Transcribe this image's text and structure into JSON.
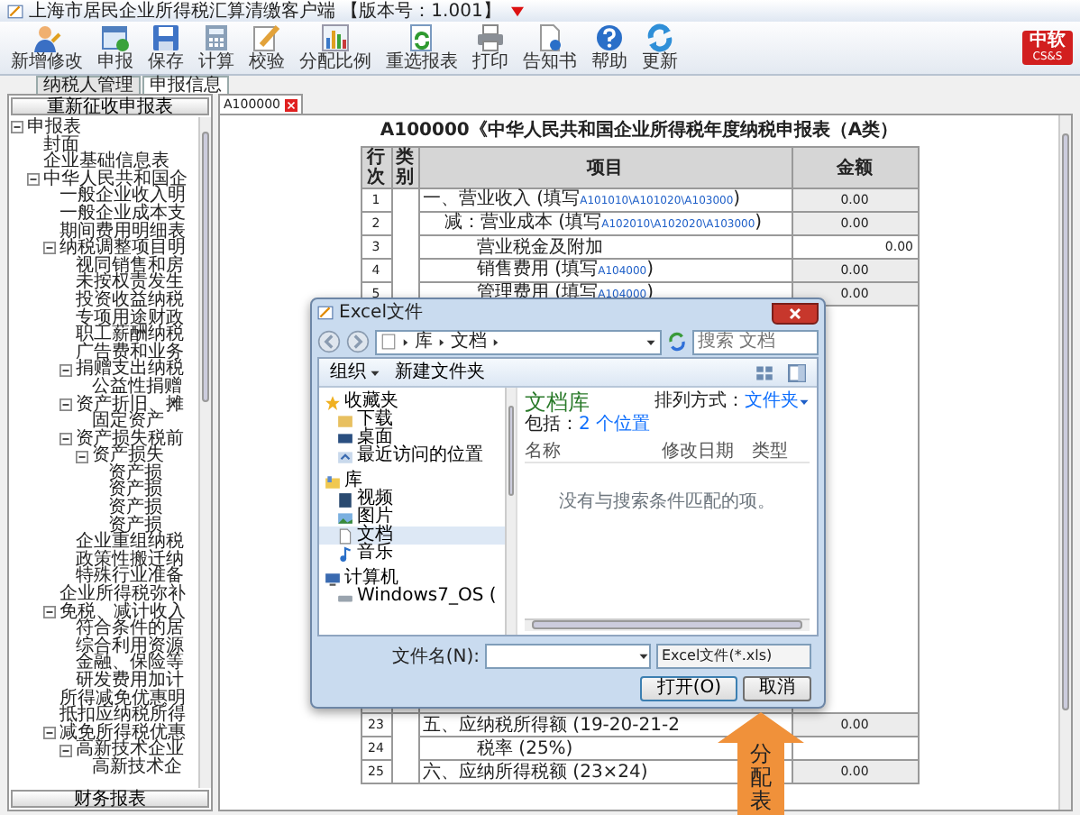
{
  "window": {
    "title": "上海市居民企业所得税汇算清缴客户端 【版本号：1.001】"
  },
  "toolbar": [
    "新增修改",
    "申报",
    "保存",
    "计算",
    "校验",
    "分配比例",
    "重选报表",
    "打印",
    "告知书",
    "帮助",
    "更新"
  ],
  "logo": {
    "text": "中软",
    "subtext": "CS&S"
  },
  "tabs": [
    {
      "label": "纳税人管理",
      "selected": false
    },
    {
      "label": "申报信息",
      "selected": true
    }
  ],
  "left_panel": {
    "top_button": "重新征收申报表",
    "bottom_button": "财务报表",
    "tree": [
      {
        "label": "申报表",
        "expanded": true,
        "children": [
          {
            "label": "封面"
          },
          {
            "label": "企业基础信息表"
          },
          {
            "label": "中华人民共和国企",
            "expanded": true,
            "children": [
              {
                "label": "一般企业收入明"
              },
              {
                "label": "一般企业成本支"
              },
              {
                "label": "期间费用明细表"
              },
              {
                "label": "纳税调整项目明",
                "expanded": true,
                "children": [
                  {
                    "label": "视同销售和房"
                  },
                  {
                    "label": "未按权责发生"
                  },
                  {
                    "label": "投资收益纳税"
                  },
                  {
                    "label": "专项用途财政"
                  },
                  {
                    "label": "职工薪酬纳税"
                  },
                  {
                    "label": "广告费和业务"
                  },
                  {
                    "label": "捐赠支出纳税",
                    "expanded": true,
                    "children": [
                      {
                        "label": "公益性捐赠"
                      }
                    ]
                  },
                  {
                    "label": "资产折旧、摊",
                    "expanded": true,
                    "children": [
                      {
                        "label": "固定资产"
                      }
                    ]
                  },
                  {
                    "label": "资产损失税前",
                    "expanded": true,
                    "children": [
                      {
                        "label": "资产损失",
                        "expanded": true,
                        "children": [
                          {
                            "label": "资产损"
                          },
                          {
                            "label": "资产损"
                          },
                          {
                            "label": "资产损"
                          },
                          {
                            "label": "资产损"
                          }
                        ]
                      }
                    ]
                  },
                  {
                    "label": "企业重组纳税"
                  },
                  {
                    "label": "政策性搬迁纳"
                  },
                  {
                    "label": "特殊行业准备"
                  }
                ]
              },
              {
                "label": "企业所得税弥补"
              },
              {
                "label": "免税、减计收入",
                "expanded": true,
                "children": [
                  {
                    "label": "符合条件的居"
                  },
                  {
                    "label": "综合利用资源"
                  },
                  {
                    "label": "金融、保险等"
                  },
                  {
                    "label": "研发费用加计"
                  }
                ]
              },
              {
                "label": "所得减免优惠明"
              },
              {
                "label": "抵扣应纳税所得"
              },
              {
                "label": "减免所得税优惠",
                "expanded": true,
                "children": [
                  {
                    "label": "高新技术企业",
                    "expanded": true,
                    "children": [
                      {
                        "label": "高新技术企"
                      }
                    ]
                  }
                ]
              }
            ]
          }
        ]
      }
    ]
  },
  "document_tabs": [
    {
      "label": "A100000",
      "selected": true
    }
  ],
  "sheet": {
    "title": "A100000《中华人民共和国企业所得税年度纳税申报表（A类）",
    "columns": [
      "行次",
      "类别",
      "项目",
      "金额"
    ],
    "rows": [
      {
        "line": "1",
        "item": "一、营业收入 (填写",
        "ref": "A101010\\A101020\\A103000",
        "item_end": ")",
        "kind": "heading",
        "amount": "0.00"
      },
      {
        "line": "2",
        "item": "减：营业成本 (填写",
        "ref": "A102010\\A102020\\A103000",
        "item_end": ")",
        "kind": "sub",
        "amount": "0.00"
      },
      {
        "line": "3",
        "item": "营业税金及附加",
        "kind": "entry",
        "amount": "0.00"
      },
      {
        "line": "4",
        "item": "销售费用 (填写",
        "ref": "A104000",
        "item_end": ")",
        "kind": "detail",
        "amount": "0.00"
      },
      {
        "line": "5",
        "item": "管理费用 (填写",
        "ref": "A104000",
        "item_end": ")",
        "kind": "detail",
        "amount": "0.00"
      },
      {
        "line": "23",
        "item": "五、应纳税所得额 (19-20-21-2",
        "kind": "heading",
        "amount": "0.00"
      },
      {
        "line": "24",
        "item": "税率 (25%)",
        "kind": "entry"
      },
      {
        "line": "25",
        "item": "六、应纳所得税额 (23×24)",
        "kind": "heading",
        "amount": "0.00"
      }
    ]
  },
  "dialog": {
    "title": "Excel文件",
    "path": [
      "库",
      "文档"
    ],
    "search_placeholder": "搜索 文档",
    "toolbar": [
      "组织",
      "新建文件夹"
    ],
    "nav": [
      {
        "label": "收藏夹",
        "kind": "group",
        "selected": false
      },
      {
        "label": "下载",
        "kind": "item",
        "selected": false
      },
      {
        "label": "桌面",
        "kind": "item",
        "selected": false
      },
      {
        "label": "最近访问的位置",
        "kind": "item",
        "selected": false
      },
      {
        "label": "库",
        "kind": "group",
        "selected": false
      },
      {
        "label": "视频",
        "kind": "item",
        "selected": false
      },
      {
        "label": "图片",
        "kind": "item",
        "selected": false
      },
      {
        "label": "文档",
        "kind": "item",
        "selected": true
      },
      {
        "label": "音乐",
        "kind": "item",
        "selected": false
      },
      {
        "label": "计算机",
        "kind": "group",
        "selected": false
      },
      {
        "label": "Windows7_OS (",
        "kind": "item",
        "selected": false
      }
    ],
    "library_title": "文档库",
    "includes_label": "包括：",
    "includes_link": "2 个位置",
    "sort_label": "排列方式：",
    "sort_value": "文件夹",
    "columns": [
      "名称",
      "修改日期",
      "类型"
    ],
    "empty_message": "没有与搜索条件匹配的项。",
    "filename_label": "文件名(N):",
    "filetype": "Excel文件(*.xls)",
    "buttons": [
      "打开(O)",
      "取消"
    ]
  },
  "annotation": {
    "text": "分配表"
  }
}
